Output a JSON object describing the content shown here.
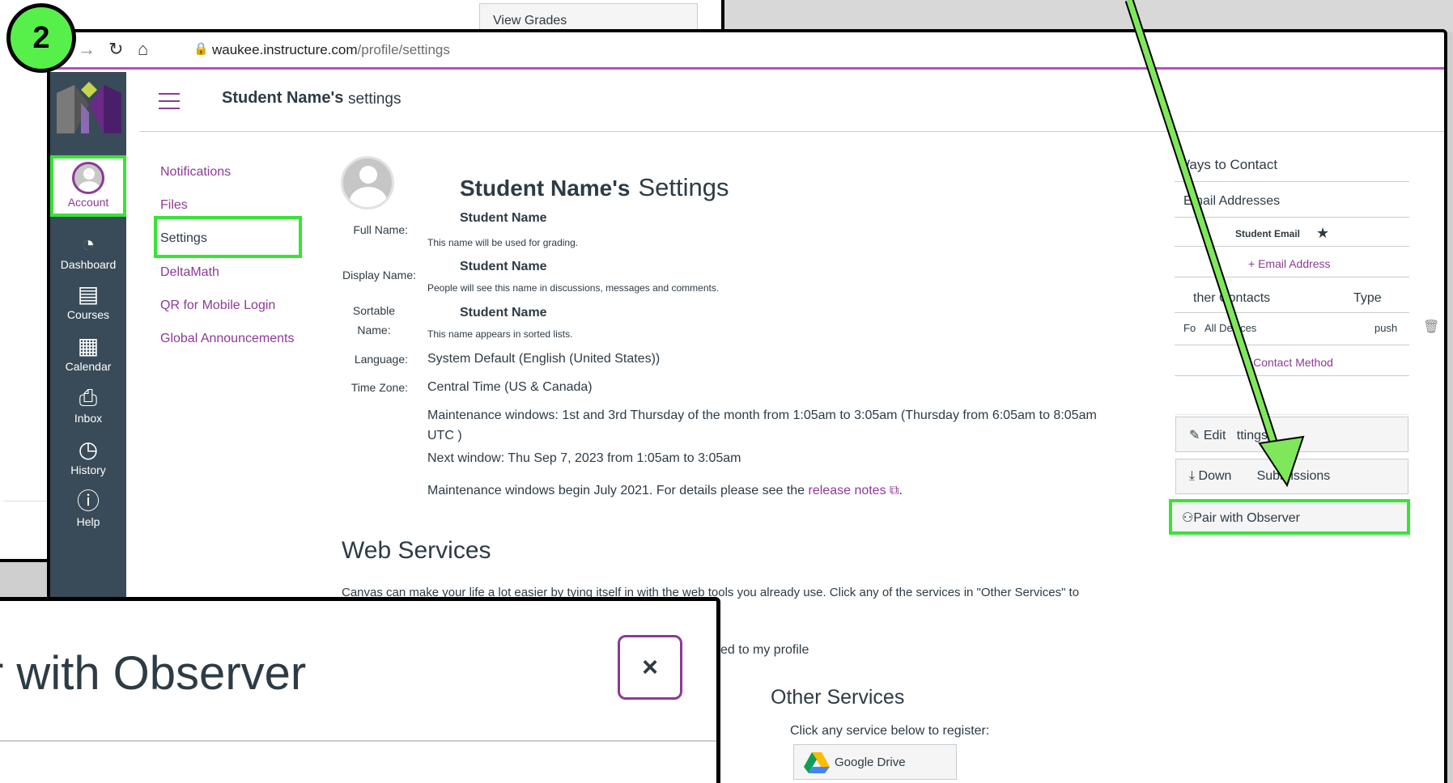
{
  "step_badge": "2",
  "background_window": {
    "view_grades_label": "View Grades"
  },
  "browser": {
    "url_host": "waukee.instructure.com",
    "url_path": "/profile/settings",
    "back_icon": "arrow-left-icon",
    "forward_icon": "arrow-right-icon",
    "reload_icon": "reload-icon",
    "home_icon": "home-icon"
  },
  "global_nav": {
    "account": "Account",
    "dashboard": "Dashboard",
    "courses": "Courses",
    "calendar": "Calendar",
    "inbox": "Inbox",
    "history": "History",
    "help": "Help"
  },
  "header": {
    "name": "Student Name's",
    "page": "settings"
  },
  "subnav": [
    "Notifications",
    "Files",
    "Settings",
    "DeltaMath",
    "QR for Mobile Login",
    "Global Announcements"
  ],
  "settings": {
    "title_name": "Student Name's",
    "title_word": "Settings",
    "full_name_label": "Full Name:",
    "full_name": "Student Name",
    "full_name_hint": "This name will be used for grading.",
    "display_name_label": "Display Name:",
    "display_name": "Student Name",
    "display_name_hint": "People will see this name in discussions, messages and comments.",
    "sortable_label_1": "Sortable",
    "sortable_label_2": "Name:",
    "sortable_name": "Student Name",
    "sortable_hint": "This name appears in sorted lists.",
    "language_label": "Language:",
    "language": "System Default (English (United States))",
    "timezone_label": "Time Zone:",
    "timezone": "Central Time (US & Canada)",
    "maint_line1": "Maintenance windows: 1st and 3rd Thursday of the month from 1:05am to 3:05am (Thursday from 6:05am to 8:05am",
    "maint_line2": "UTC )",
    "next_window": "Next window: Thu Sep 7, 2023 from 1:05am to 3:05am",
    "maint_begin": "Maintenance windows begin July 2021. For details please see the",
    "release_notes": "release notes",
    "period": "."
  },
  "web_services": {
    "title": "Web Services",
    "desc": "Canvas can make your life a lot easier by tying itself in with the web tools you already use. Click any of the services in \"Other Services\" to",
    "linked_fragment": "ed to my profile",
    "other_title": "Other Services",
    "other_desc": "Click any service below to register:",
    "google_drive": "Google Drive"
  },
  "right_side": {
    "ways_to_contact": "Ways to Contact",
    "email_addresses": "Email Addresses",
    "student_email": "Student Email",
    "add_email": "Email Address",
    "other_contacts": "ther Contacts",
    "type_header": "Type",
    "contact_name": "Fo",
    "contact_name_rest": "All Devices",
    "contact_type": "push",
    "add_contact": "Contact Method",
    "edit_settings_a": "Edit",
    "edit_settings_b": "ttings",
    "download_a": "Down",
    "download_b": "Submissions",
    "pair_observer": "Pair with Observer"
  },
  "modal": {
    "title": "r with Observer",
    "close": "×"
  },
  "colors": {
    "highlight": "#39e336",
    "brand": "#8d3a96",
    "arrow": "#7fe85a"
  }
}
